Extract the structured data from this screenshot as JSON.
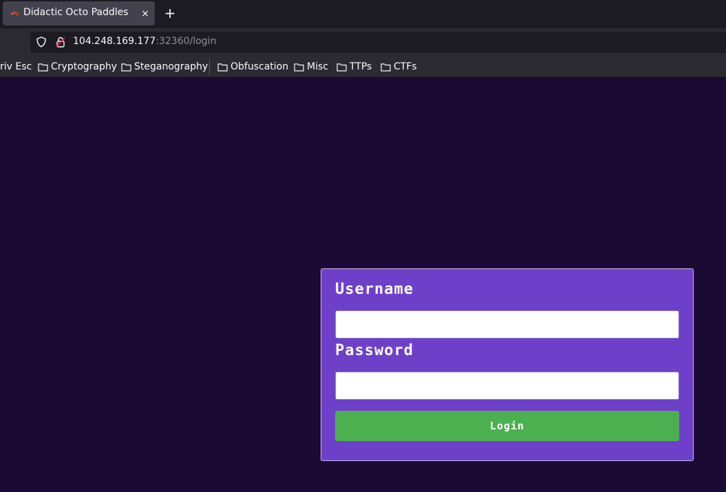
{
  "browser": {
    "tab": {
      "title": "Didactic Octo Paddles",
      "close_label": "×"
    },
    "new_tab_label": "+",
    "url": {
      "host": "104.248.169.177",
      "path": ":32360/login"
    },
    "bookmarks": [
      "riv Esc",
      "Cryptography",
      "Steganography",
      "Obfuscation",
      "Misc",
      "TTPs",
      "CTFs"
    ]
  },
  "login": {
    "username_label": "Username",
    "username_value": "",
    "password_label": "Password",
    "password_value": "",
    "button_label": "Login"
  },
  "colors": {
    "page_background": "#1b0a33",
    "card_background": "#6e40c9",
    "button_background": "#4caf50"
  }
}
